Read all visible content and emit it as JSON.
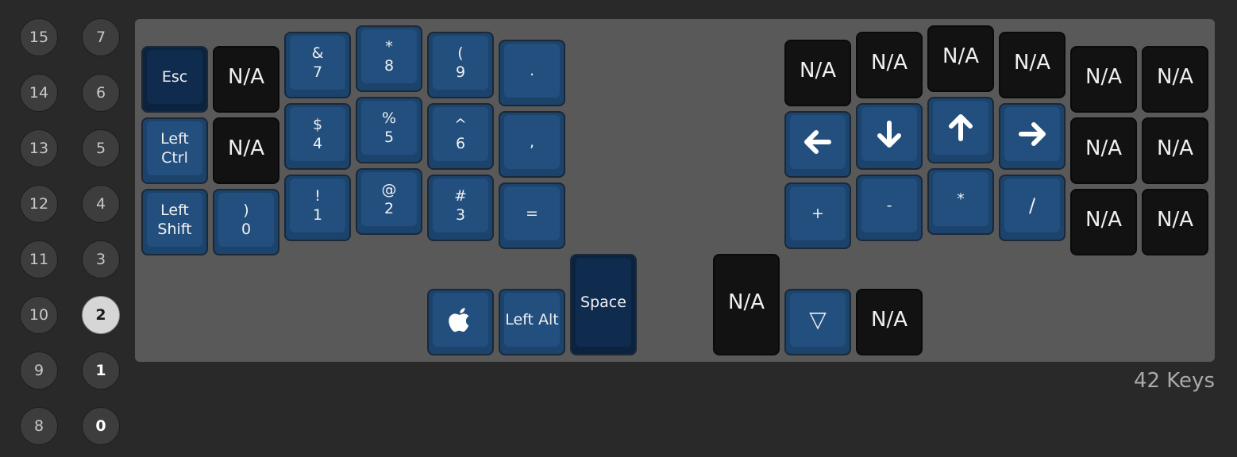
{
  "layers": {
    "left_column": [
      "15",
      "14",
      "13",
      "12",
      "11",
      "10",
      "9",
      "8"
    ],
    "right_column": [
      "7",
      "6",
      "5",
      "4",
      "3",
      "2",
      "1",
      "0"
    ],
    "selected": "2"
  },
  "keys": {
    "esc": "Esc",
    "na": "N/A",
    "amp_top": "&",
    "amp_bottom": "7",
    "star_top": "*",
    "star_bottom": "8",
    "paren_top": "(",
    "paren_bottom": "9",
    "period": ".",
    "left_ctrl_1": "Left",
    "left_ctrl_2": "Ctrl",
    "dollar_top": "$",
    "dollar_bottom": "4",
    "percent_top": "%",
    "percent_bottom": "5",
    "caret_top": "^",
    "caret_bottom": "6",
    "comma": ",",
    "left_shift_1": "Left",
    "left_shift_2": "Shift",
    "rparen_top": ")",
    "rparen_bottom": "0",
    "bang_top": "!",
    "bang_bottom": "1",
    "at_top": "@",
    "at_bottom": "2",
    "hash_top": "#",
    "hash_bottom": "3",
    "equals": "=",
    "left_alt": "Left Alt",
    "space": "Space",
    "down_triangle": "▽",
    "plus": "+",
    "minus": "-",
    "asterisk": "*",
    "slash": "/"
  },
  "icons": {
    "apple": "apple-logo-icon",
    "left": "arrow-left-icon",
    "down": "arrow-down-icon",
    "up": "arrow-up-icon",
    "right": "arrow-right-icon"
  },
  "footer": {
    "key_count": "42 Keys"
  },
  "colors": {
    "key_blue": "#224f7e",
    "key_dark": "#0f2c4f",
    "key_na": "#121212",
    "board": "#595959",
    "background": "#292929"
  }
}
